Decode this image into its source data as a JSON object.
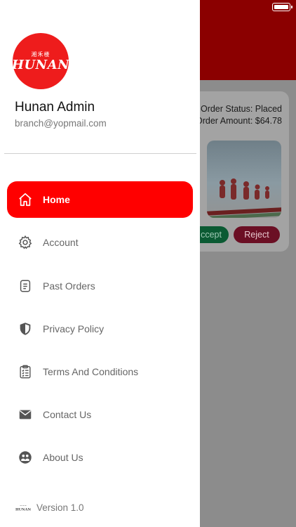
{
  "status_bar": {
    "battery_icon": "battery-icon"
  },
  "order": {
    "status": "Order Status: Placed",
    "amount": "Order Amount: $64.78",
    "accept_label": "ccept",
    "reject_label": "Reject"
  },
  "drawer": {
    "logo": {
      "script": "湘禾楼",
      "text": "HUNAN"
    },
    "user_name": "Hunan Admin",
    "user_email": "branch@yopmail.com",
    "menu": [
      {
        "label": "Home",
        "icon": "home-icon",
        "active": true
      },
      {
        "label": "Account",
        "icon": "gear-icon",
        "active": false
      },
      {
        "label": "Past Orders",
        "icon": "receipt-icon",
        "active": false
      },
      {
        "label": "Privacy Policy",
        "icon": "shield-icon",
        "active": false
      },
      {
        "label": "Terms And Conditions",
        "icon": "clipboard-icon",
        "active": false
      },
      {
        "label": "Contact Us",
        "icon": "mail-icon",
        "active": false
      },
      {
        "label": "About Us",
        "icon": "people-icon",
        "active": false
      }
    ],
    "version": "Version 1.0"
  },
  "colors": {
    "accent": "#ff0000",
    "logo": "#ee1c1c",
    "header": "#8b0000"
  }
}
